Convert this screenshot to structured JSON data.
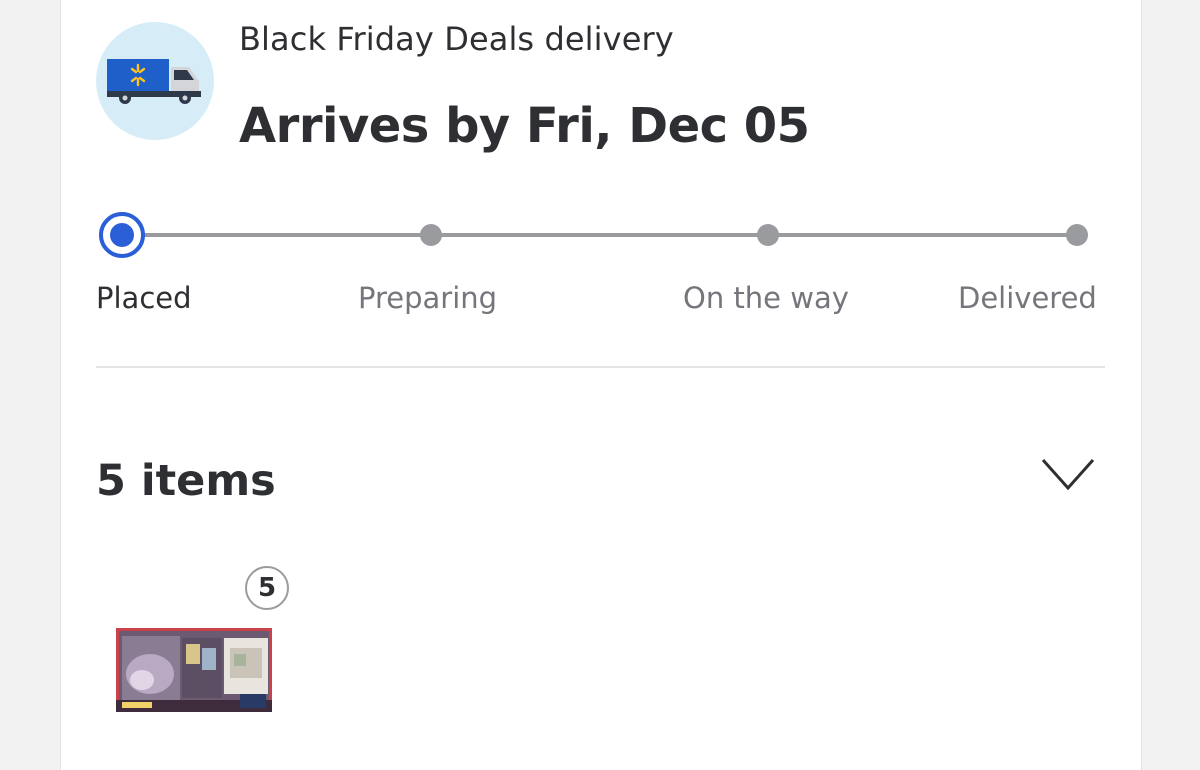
{
  "delivery": {
    "subtitle": "Black Friday Deals delivery",
    "headline": "Arrives by Fri, Dec 05",
    "icon": "delivery-truck-icon"
  },
  "tracker": {
    "current_step": "Placed",
    "steps": [
      {
        "label": "Placed",
        "state": "active"
      },
      {
        "label": "Preparing",
        "state": "pending"
      },
      {
        "label": "On the way",
        "state": "pending"
      },
      {
        "label": "Delivered",
        "state": "pending"
      }
    ],
    "active_color": "#2a5fd8",
    "inactive_color": "#9a9b9f"
  },
  "items": {
    "title": "5 items",
    "expand_icon": "chevron-down-icon",
    "products": [
      {
        "quantity": "5",
        "image": "product-thumbnail"
      }
    ]
  }
}
